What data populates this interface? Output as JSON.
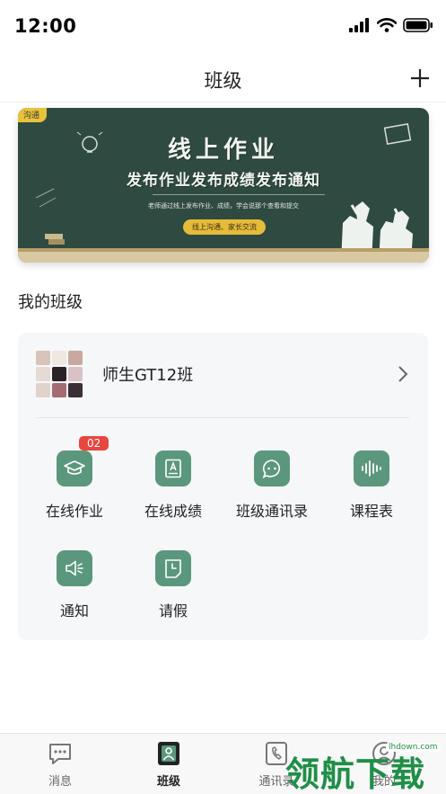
{
  "status_bar": {
    "time": "12:00"
  },
  "nav": {
    "title": "班级"
  },
  "banner": {
    "tag": "沟通",
    "title": "线上作业",
    "subtitle": "发布作业发布成绩发布通知",
    "small_text": "老师通过线上发布作业、成绩，学会说那个查看和提交",
    "pill": "线上沟通、家长交流"
  },
  "section": {
    "title": "我的班级"
  },
  "class_card": {
    "name": "师生GT12班",
    "functions": [
      {
        "label": "在线作业",
        "icon": "graduation-cap-icon",
        "badge": "02"
      },
      {
        "label": "在线成绩",
        "icon": "score-sheet-icon"
      },
      {
        "label": "班级通讯录",
        "icon": "chat-bubble-icon"
      },
      {
        "label": "课程表",
        "icon": "audio-wave-icon"
      },
      {
        "label": "通知",
        "icon": "speaker-icon"
      },
      {
        "label": "请假",
        "icon": "clock-calendar-icon"
      }
    ]
  },
  "tab_bar": {
    "tabs": [
      {
        "label": "消息",
        "icon": "message-icon"
      },
      {
        "label": "班级",
        "icon": "class-icon",
        "active": true
      },
      {
        "label": "通讯录",
        "icon": "contacts-icon"
      },
      {
        "label": "我的",
        "icon": "profile-icon"
      }
    ]
  },
  "watermark": {
    "text": "领航下载",
    "url": "lhdown.com"
  },
  "colors": {
    "accent": "#5b977c",
    "badge": "#e8463f",
    "banner_bg": "#2f4a41"
  }
}
